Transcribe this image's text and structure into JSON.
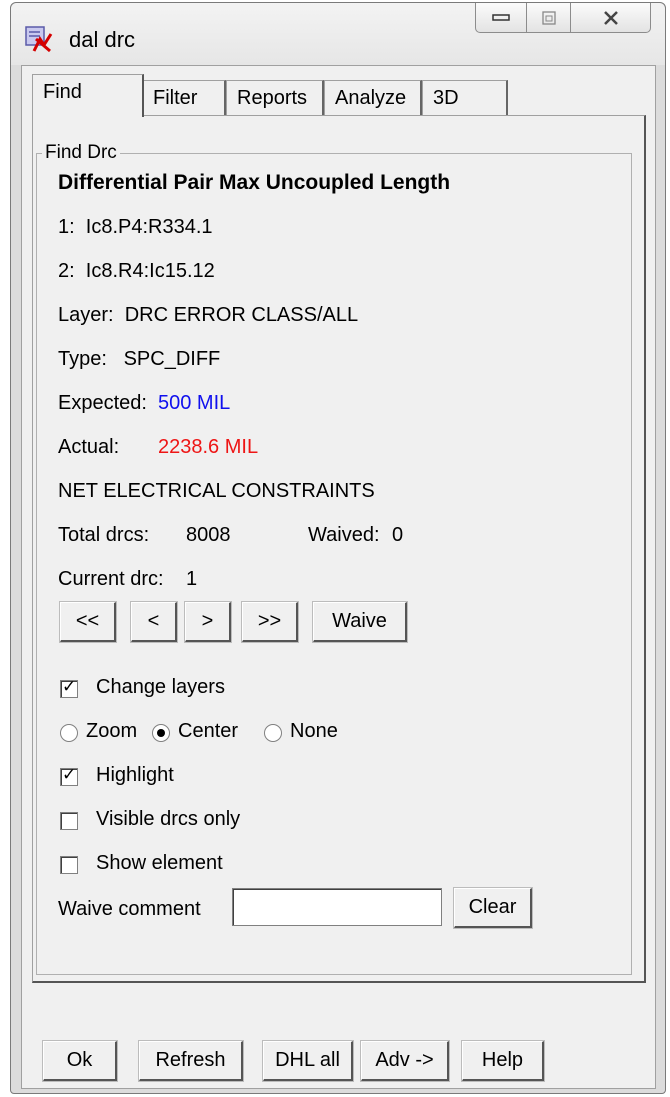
{
  "window": {
    "title": "dal drc",
    "app_icon": "drc-app-icon",
    "controls": [
      "minimize-icon",
      "maximize-icon",
      "close-icon"
    ]
  },
  "tabs": [
    {
      "label": "Find",
      "active": true
    },
    {
      "label": "Filter",
      "active": false
    },
    {
      "label": "Reports",
      "active": false
    },
    {
      "label": "Analyze",
      "active": false
    },
    {
      "label": "3D",
      "active": false
    }
  ],
  "find": {
    "group_label": "Find Drc",
    "heading": "Differential Pair Max Uncoupled Length",
    "item1": "1:  Ic8.P4:R334.1",
    "item2": "2:  Ic8.R4:Ic15.12",
    "layer": "Layer:  DRC ERROR CLASS/ALL",
    "type": "Type:   SPC_DIFF",
    "expected_label": "Expected:",
    "expected_value": "500 MIL",
    "actual_label": "Actual:",
    "actual_value": "2238.6 MIL",
    "constraint": "NET ELECTRICAL CONSTRAINTS",
    "total_label": "Total drcs:",
    "total_value": "8008",
    "waived_label": "Waived:",
    "waived_value": "0",
    "current_label": "Current drc:",
    "current_value": "1",
    "nav_buttons": [
      "<<",
      "<",
      ">",
      ">>"
    ],
    "waive_button": "Waive",
    "change_layers": {
      "label": "Change layers",
      "checked": true
    },
    "view_mode": {
      "options": [
        "Zoom",
        "Center",
        "None"
      ],
      "selected": "Center"
    },
    "highlight": {
      "label": "Highlight",
      "checked": true
    },
    "visible_only": {
      "label": "Visible drcs only",
      "checked": false
    },
    "show_element": {
      "label": "Show element",
      "checked": false
    },
    "waive_comment_label": "Waive comment",
    "waive_comment_value": "",
    "clear_button": "Clear"
  },
  "footer": {
    "buttons": [
      "Ok",
      "Refresh",
      "DHL all",
      "Adv ->",
      "Help"
    ]
  },
  "colors": {
    "expected": "#1010ee",
    "actual": "#ee1515"
  }
}
